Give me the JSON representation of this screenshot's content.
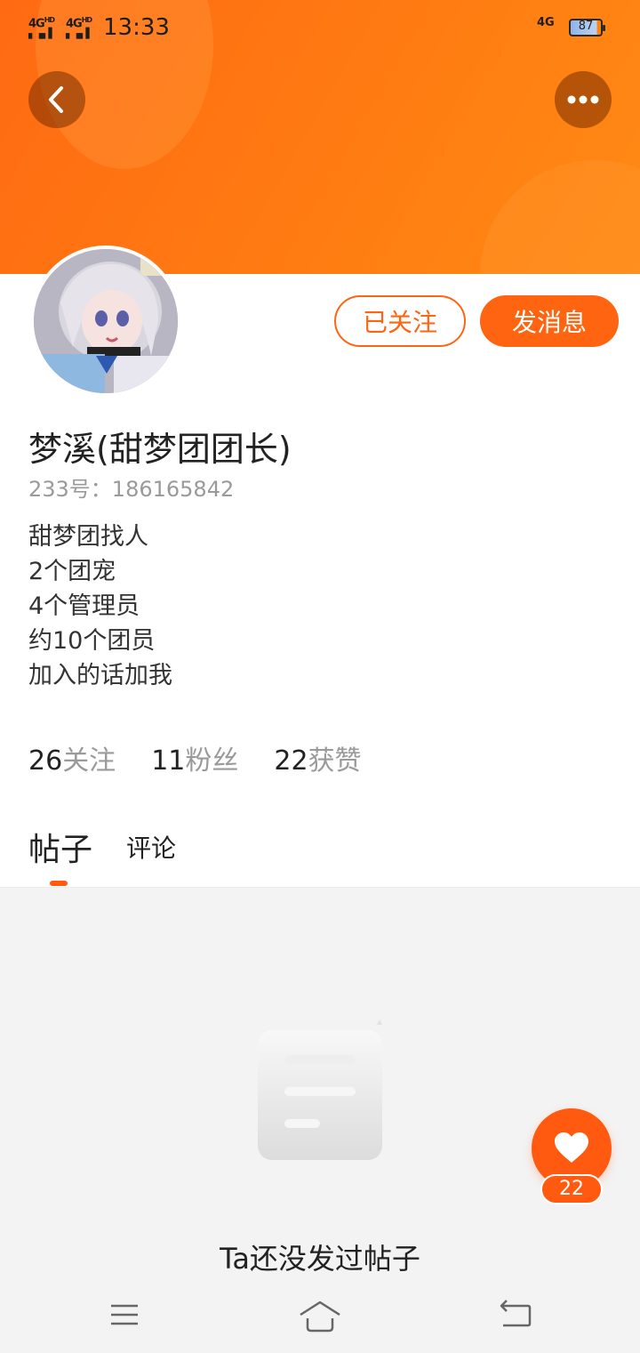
{
  "status_bar": {
    "signal1": "4G",
    "signal1_sup": "HD",
    "signal2": "4G",
    "signal2_sup": "HD",
    "time": "13:33",
    "network": "4G",
    "battery": "87"
  },
  "header": {
    "back_icon": "chevron-left-icon",
    "more_icon": "more-horizontal-icon",
    "accent_color": "#ff6a13"
  },
  "profile": {
    "avatar_alt": "avatar",
    "follow_label": "已关注",
    "message_label": "发消息",
    "username": "梦溪(甜梦团团长)",
    "uid": "233号：186165842",
    "bio": [
      "甜梦团找人",
      "2个团宠",
      "4个管理员",
      "约10个团员",
      "加入的话加我"
    ],
    "stats": [
      {
        "num": "26",
        "label": "关注"
      },
      {
        "num": "11",
        "label": "粉丝"
      },
      {
        "num": "22",
        "label": "获赞"
      }
    ]
  },
  "tabs": {
    "posts": "帖子",
    "comments": "评论",
    "active": "posts"
  },
  "empty": {
    "text": "Ta还没发过帖子",
    "icon": "document-icon"
  },
  "like_fab": {
    "icon": "heart-icon",
    "count": "22"
  },
  "navbar": {
    "menu_icon": "menu-icon",
    "home_icon": "home-icon",
    "back_icon": "back-icon"
  }
}
